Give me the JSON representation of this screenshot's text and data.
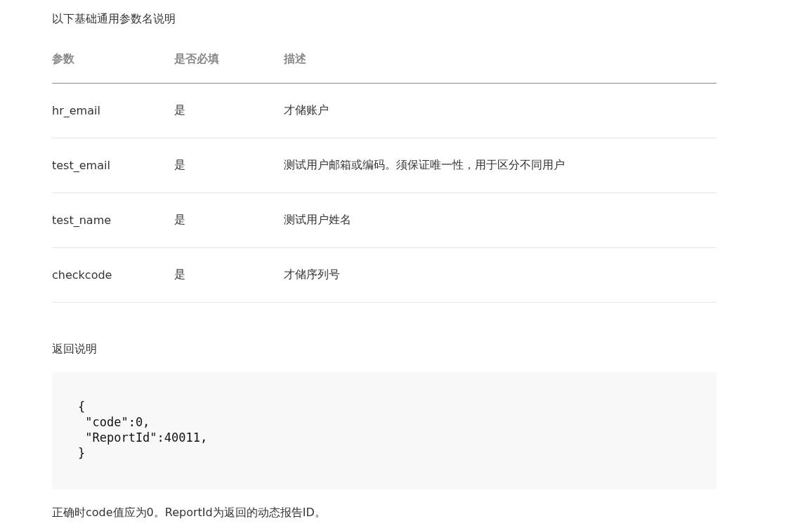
{
  "intro": "以下基础通用参数名说明",
  "table": {
    "columns": [
      "参数",
      "是否必填",
      "描述"
    ],
    "rows": [
      [
        "hr_email",
        "是",
        "才储账户"
      ],
      [
        "test_email",
        "是",
        "测试用户邮箱或编码。须保证唯一性，用于区分不同用户"
      ],
      [
        "test_name",
        "是",
        "测试用户姓名"
      ],
      [
        "checkcode",
        "是",
        "才储序列号"
      ]
    ]
  },
  "return_heading": "返回说明",
  "code_lines": [
    "{",
    " \"code\":0,",
    " \"ReportId\":40011,",
    "}"
  ],
  "note": "正确时code值应为0。ReportId为返回的动态报告ID。"
}
